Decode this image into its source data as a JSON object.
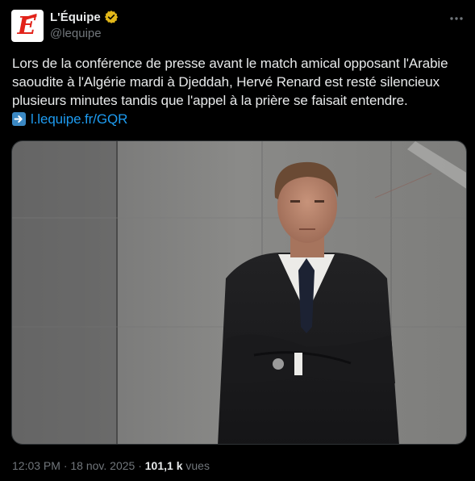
{
  "author": {
    "display_name": "L'Équipe",
    "handle": "@lequipe",
    "avatar_letter": "E",
    "verified_color": "#e2b719"
  },
  "tweet": {
    "text_lines": [
      "Lors de la conférence de presse avant le match amical opposant l'Arabie",
      "saoudite à l'Algérie mardi à Djeddah, Hervé Renard est resté silencieux",
      "plusieurs minutes tandis que l'appel à la prière se faisait entendre."
    ],
    "link_icon": "right-arrow-emoji",
    "link_text": "l.lequipe.fr/GQR"
  },
  "meta": {
    "time": "12:03 PM",
    "separator1": " · ",
    "date": "18 nov. 2025",
    "separator2": " · ",
    "views_count": "101,1 k",
    "views_label": " vues"
  },
  "colors": {
    "background": "#000000",
    "text": "#e7e9ea",
    "secondary": "#71767b",
    "link": "#1d9bf0",
    "brand_red": "#e2231a"
  }
}
